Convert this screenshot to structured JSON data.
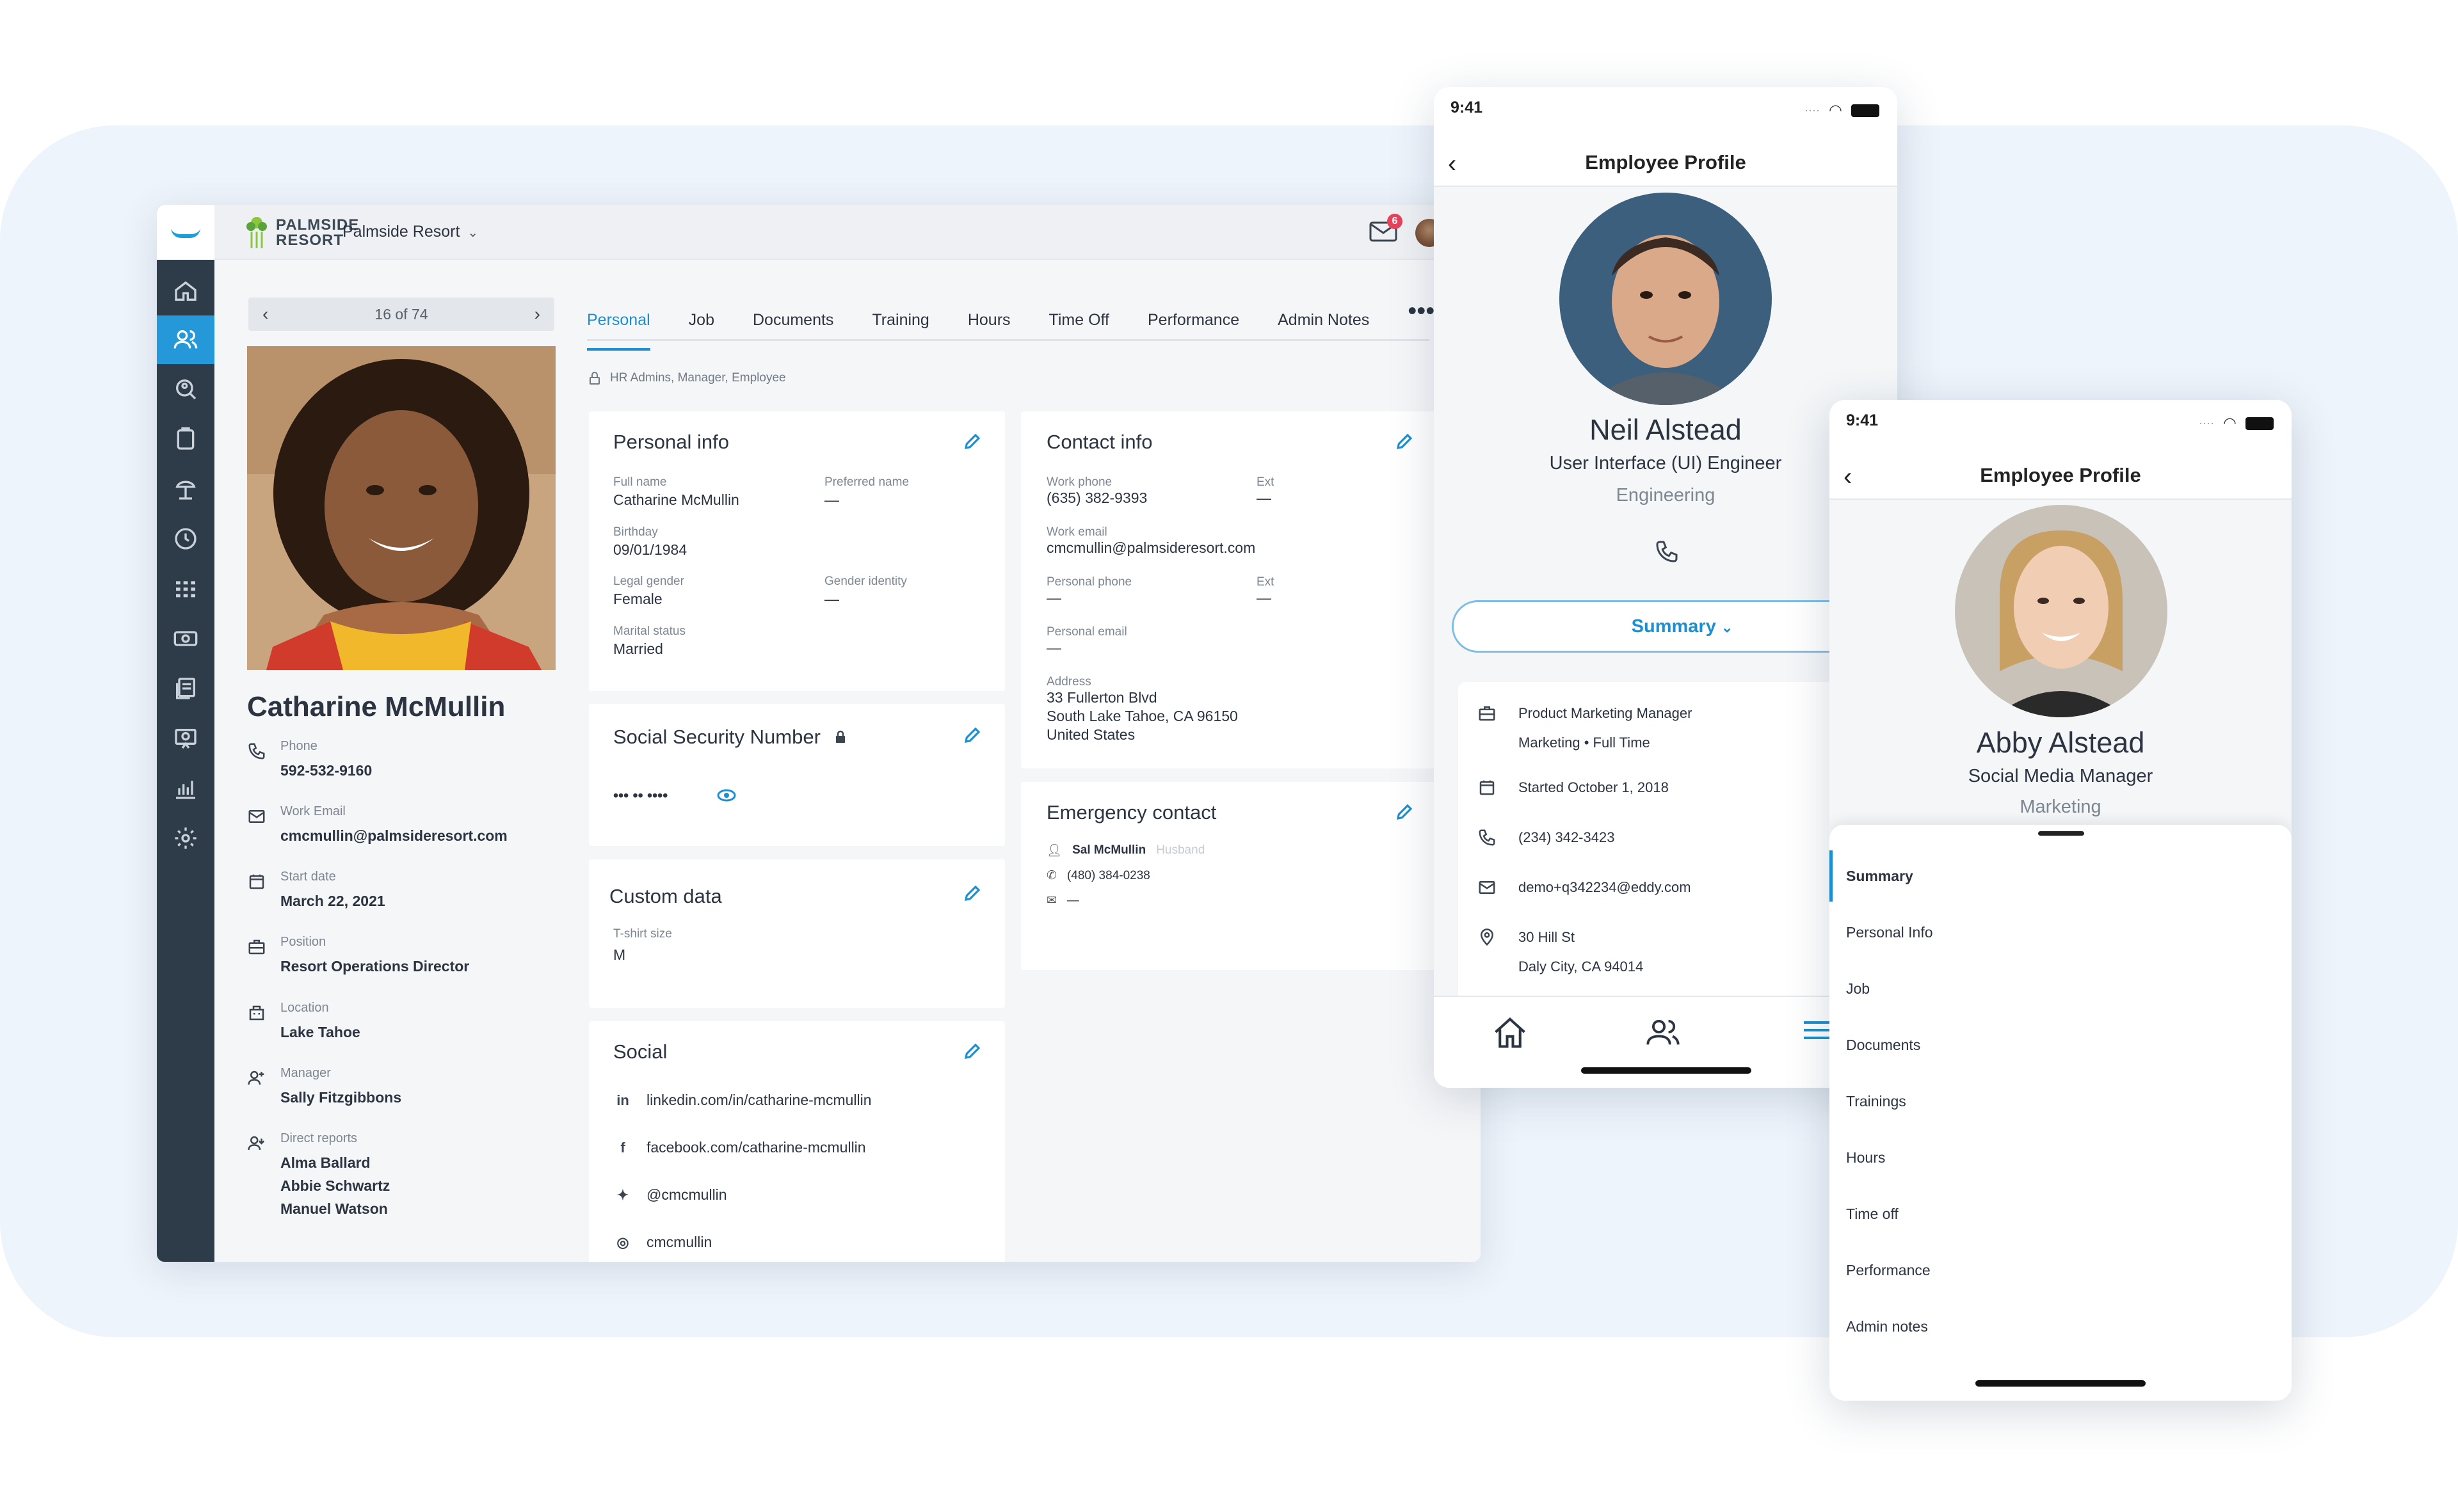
{
  "desktop": {
    "brand": {
      "line1": "PALMSIDE",
      "line2": "RESORT"
    },
    "company": "Palmside Resort",
    "mail_badge": "6",
    "pager": {
      "text": "16 of 74"
    },
    "tabs": [
      "Personal",
      "Job",
      "Documents",
      "Training",
      "Hours",
      "Time Off",
      "Performance",
      "Admin Notes"
    ],
    "permissions": "HR Admins, Manager, Employee",
    "employee": {
      "name": "Catharine McMullin",
      "details": [
        {
          "label": "Phone",
          "value": "592-532-9160"
        },
        {
          "label": "Work Email",
          "value": "cmcmullin@palmsideresort.com"
        },
        {
          "label": "Start date",
          "value": "March 22, 2021"
        },
        {
          "label": "Position",
          "value": "Resort Operations Director"
        },
        {
          "label": "Location",
          "value": "Lake Tahoe"
        },
        {
          "label": "Manager",
          "value": "Sally Fitzgibbons"
        },
        {
          "label": "Direct reports",
          "value1": "Alma Ballard",
          "value2": "Abbie Schwartz",
          "value3": "Manuel Watson"
        }
      ]
    },
    "personal_info": {
      "title": "Personal info",
      "full_name_label": "Full name",
      "full_name": "Catharine McMullin",
      "preferred_label": "Preferred name",
      "preferred": "—",
      "birthday_label": "Birthday",
      "birthday": "09/01/1984",
      "gender_label": "Legal gender",
      "gender": "Female",
      "identity_label": "Gender identity",
      "identity": "—",
      "marital_label": "Marital status",
      "marital": "Married"
    },
    "ssn": {
      "title": "Social Security Number",
      "value": "••• •• ••••"
    },
    "custom": {
      "title": "Custom data",
      "label": "T-shirt size",
      "value": "M"
    },
    "social": {
      "title": "Social",
      "linkedin": "linkedin.com/in/catharine-mcmullin",
      "facebook": "facebook.com/catharine-mcmullin",
      "twitter": "@cmcmullin",
      "instagram": "cmcmullin"
    },
    "contact": {
      "title": "Contact info",
      "work_phone_label": "Work phone",
      "work_phone": "(635) 382-9393",
      "ext_label": "Ext",
      "ext": "—",
      "work_email_label": "Work email",
      "work_email": "cmcmullin@palmsideresort.com",
      "personal_phone_label": "Personal phone",
      "personal_phone": "—",
      "ext2_label": "Ext",
      "ext2": "—",
      "personal_email_label": "Personal email",
      "personal_email": "—",
      "address_label": "Address",
      "address1": "33 Fullerton Blvd",
      "address2": "South Lake Tahoe, CA 96150",
      "address3": "United States"
    },
    "emergency": {
      "title": "Emergency contact",
      "name": "Sal McMullin",
      "relation": "Husband",
      "phone": "(480) 384-0238",
      "email": "—"
    }
  },
  "phone1": {
    "time": "9:41",
    "title": "Employee Profile",
    "name": "Neil Alstead",
    "role": "User Interface (UI) Engineer",
    "dept": "Engineering",
    "summary_label": "Summary",
    "rows": {
      "job1": "Product Marketing Manager",
      "job2": "Marketing • Full Time",
      "start": "Started October 1, 2018",
      "phone": "(234) 342-3423",
      "email": "demo+q342234@eddy.com",
      "addr1": "30 Hill St",
      "addr2": "Daly City, CA 94014"
    }
  },
  "phone2": {
    "time": "9:41",
    "title": "Employee Profile",
    "name": "Abby Alstead",
    "role": "Social Media Manager",
    "dept": "Marketing",
    "menu": [
      "Summary",
      "Personal Info",
      "Job",
      "Documents",
      "Trainings",
      "Hours",
      "Time off",
      "Performance",
      "Admin notes"
    ]
  },
  "colors": {
    "accent": "#1a8fd1",
    "rail": "#2e3b48",
    "badge": "#e6425a"
  }
}
